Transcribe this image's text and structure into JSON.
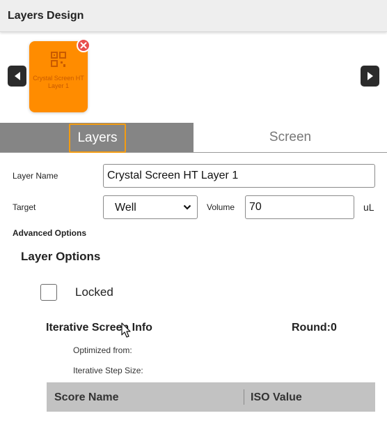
{
  "header": {
    "title": "Layers Design"
  },
  "carousel": {
    "prev_icon": "chevron-left-icon",
    "next_icon": "chevron-right-icon",
    "cards": [
      {
        "label": "Crystal Screen HT Layer 1",
        "icon": "layer-grid-icon",
        "color": "#ff8c00",
        "remove_icon": "close-icon"
      }
    ]
  },
  "tabs": [
    {
      "label": "Layers",
      "active": true
    },
    {
      "label": "Screen",
      "active": false
    }
  ],
  "form": {
    "layer_name_label": "Layer Name",
    "layer_name_value": "Crystal Screen HT Layer 1",
    "target_label": "Target",
    "target_value": "Well",
    "volume_label": "Volume",
    "volume_value": "70",
    "volume_unit": "uL"
  },
  "advanced": {
    "title": "Advanced Options",
    "layer_options_title": "Layer Options",
    "locked_label": "Locked",
    "locked_checked": false
  },
  "iterative": {
    "title": "Iterative Screen Info",
    "round": "Round:0",
    "optimized_from_label": "Optimized from:",
    "step_size_label": "Iterative Step Size:"
  },
  "table": {
    "columns": [
      "Score Name",
      "ISO Value"
    ]
  },
  "colors": {
    "accent_orange": "#ff8c00",
    "tab_active_bg": "#858585",
    "tab_focus_border": "#f39c12",
    "remove_red": "#e84e4e"
  }
}
